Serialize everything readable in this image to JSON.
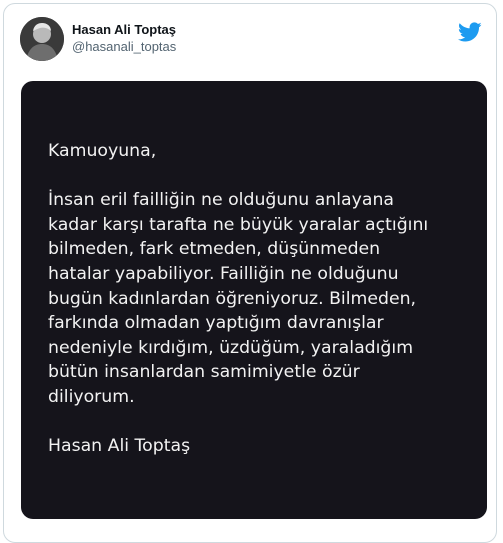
{
  "tweet": {
    "author": {
      "display_name": "Hasan Ali Toptaş",
      "handle": "@hasanali_toptas"
    },
    "brand_icon": "twitter-bird-icon",
    "brand_color": "#1d9bf0",
    "image_text": {
      "salutation": "Kamuoyuna,",
      "body_lines": [
        "İnsan eril failliğin ne olduğunu anlayana",
        "kadar karşı tarafta ne büyük yaralar açtığını",
        "bilmeden, fark etmeden, düşünmeden",
        "hatalar yapabiliyor. Failliğin ne olduğunu",
        "bugün kadınlardan öğreniyoruz. Bilmeden,",
        "farkında olmadan yaptığım davranışlar",
        "nedeniyle kırdığım, üzdüğüm, yaraladığım",
        "bütün insanlardan samimiyetle özür",
        "diliyorum."
      ],
      "signature": "Hasan Ali Toptaş"
    }
  }
}
